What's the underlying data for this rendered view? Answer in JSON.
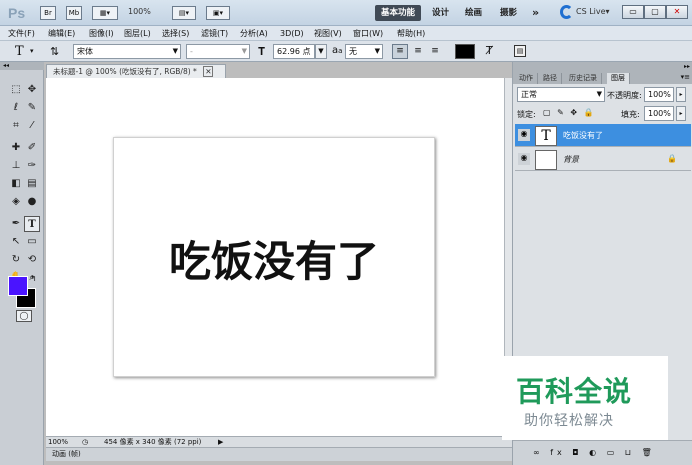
{
  "titlebar": {
    "app_icon": "Ps",
    "btn_br": "Br",
    "btn_mb": "Mb",
    "zoom": "100%",
    "workspaces": [
      "基本功能",
      "设计",
      "绘画",
      "摄影"
    ],
    "more": "»",
    "cslive": "CS Live▾"
  },
  "menu": [
    "文件(F)",
    "编辑(E)",
    "图像(I)",
    "图层(L)",
    "选择(S)",
    "滤镜(T)",
    "分析(A)",
    "3D(D)",
    "视图(V)",
    "窗口(W)",
    "帮助(H)"
  ],
  "options": {
    "tool_glyph": "T",
    "font_family": "宋体",
    "font_style": "-",
    "font_size": "62.96 点",
    "aa_label": "a",
    "aa_sub": "a",
    "antialias": "无"
  },
  "document": {
    "tab_title": "未标题-1 @ 100% (吃饭没有了, RGB/8) *",
    "canvas_text": "吃饭没有了",
    "status_zoom": "100%",
    "status_info": "454 像素 x 340 像素 (72 ppi)",
    "anim_label": "动画 (帧)"
  },
  "panel": {
    "tabs": [
      "动作",
      "路径",
      "历史记录",
      "图层"
    ],
    "blend_mode": "正常",
    "opacity_label": "不透明度:",
    "opacity": "100%",
    "lock_label": "锁定:",
    "fill_label": "填充:",
    "fill": "100%",
    "layers": [
      {
        "name": "吃饭没有了",
        "thumb": "T"
      },
      {
        "name": "背景",
        "thumb": ""
      }
    ],
    "footer_icons": "∞  fx  ◘  ◐  ▭  ⊔  🗑"
  },
  "watermark": {
    "title": "百科全说",
    "subtitle": "助你轻松解决"
  },
  "colors": {
    "foreground": "#4a14ff",
    "background": "#000000",
    "layer_selected": "#3d8fe0",
    "workspace_active": "#404a56"
  }
}
